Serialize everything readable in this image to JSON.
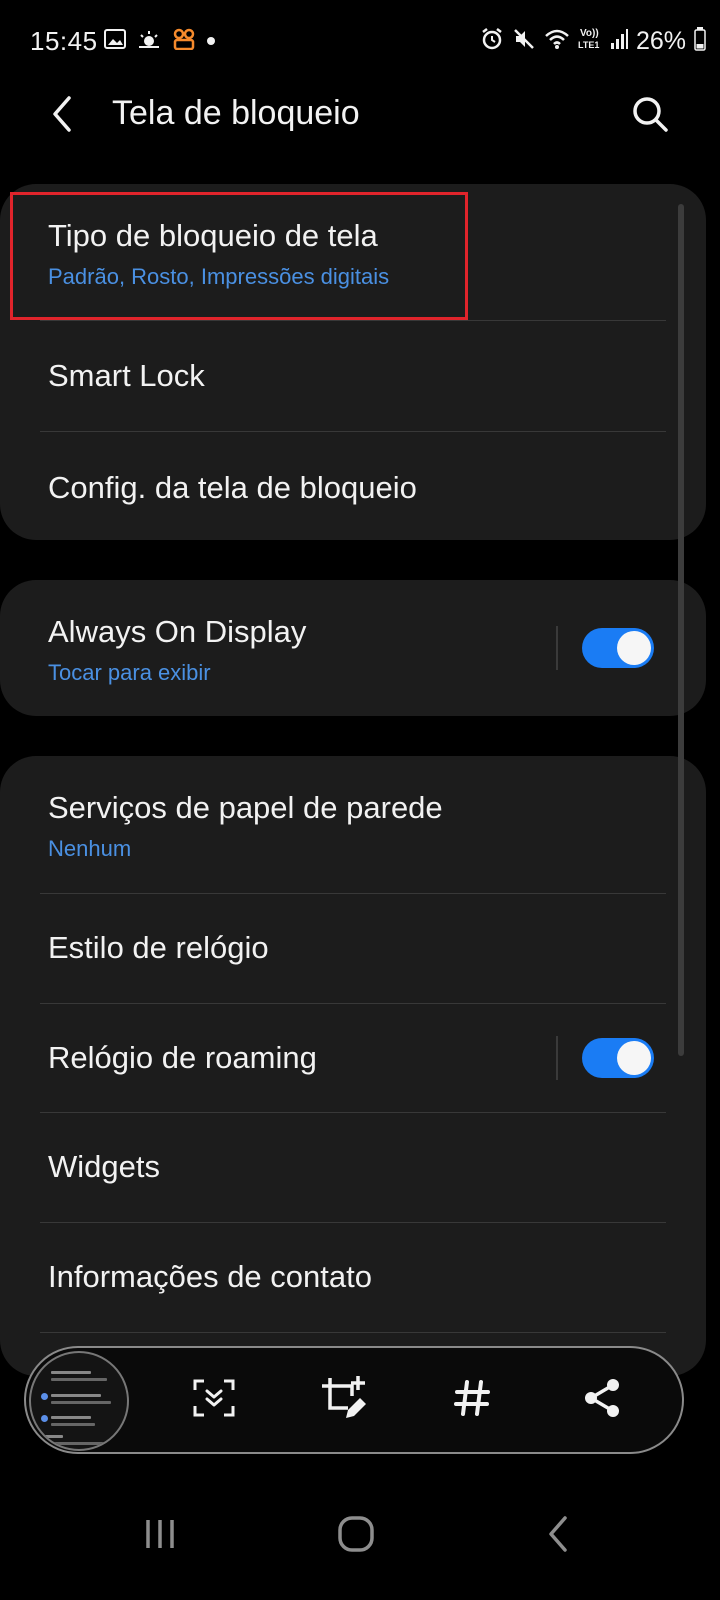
{
  "status_bar": {
    "time": "15:45",
    "left_icons": [
      "gallery-icon",
      "weather-icon",
      "app-notification-icon",
      "dot-icon"
    ],
    "right_icons": [
      "alarm-icon",
      "mute-icon",
      "wifi-icon",
      "volte-icon",
      "signal-icon",
      "battery-icon"
    ],
    "volte_label": "Vo)) LTE1",
    "battery_text": "26%"
  },
  "app_bar": {
    "title": "Tela de bloqueio",
    "back_icon": "chevron-left-icon",
    "search_icon": "search-icon"
  },
  "card1": {
    "items": [
      {
        "title": "Tipo de bloqueio de tela",
        "subtitle": "Padrão, Rosto, Impressões digitais"
      },
      {
        "title": "Smart Lock"
      },
      {
        "title": "Config. da tela de bloqueio"
      }
    ]
  },
  "card2": {
    "items": [
      {
        "title": "Always On Display",
        "subtitle": "Tocar para exibir",
        "toggle": true
      }
    ]
  },
  "card3": {
    "items": [
      {
        "title": "Serviços de papel de parede",
        "subtitle": "Nenhum"
      },
      {
        "title": "Estilo de relógio"
      },
      {
        "title": "Relógio de roaming",
        "toggle": true
      },
      {
        "title": "Widgets"
      },
      {
        "title": "Informações de contato"
      }
    ]
  },
  "screenshot_toolbar": {
    "thumbnail_lines": [
      "Tela de bloqueio",
      "Biometria e segurança",
      "Privacidade",
      "Local"
    ],
    "tools": [
      "scroll-capture-icon",
      "crop-edit-icon",
      "hashtag-icon",
      "share-icon"
    ]
  },
  "nav_bar": {
    "buttons": [
      "recents-icon",
      "home-icon",
      "back-icon"
    ]
  },
  "colors": {
    "background": "#000000",
    "card": "#1c1c1c",
    "accent_blue": "#4a90e2",
    "toggle_on": "#1a7cf4",
    "highlight": "#e0242b"
  }
}
